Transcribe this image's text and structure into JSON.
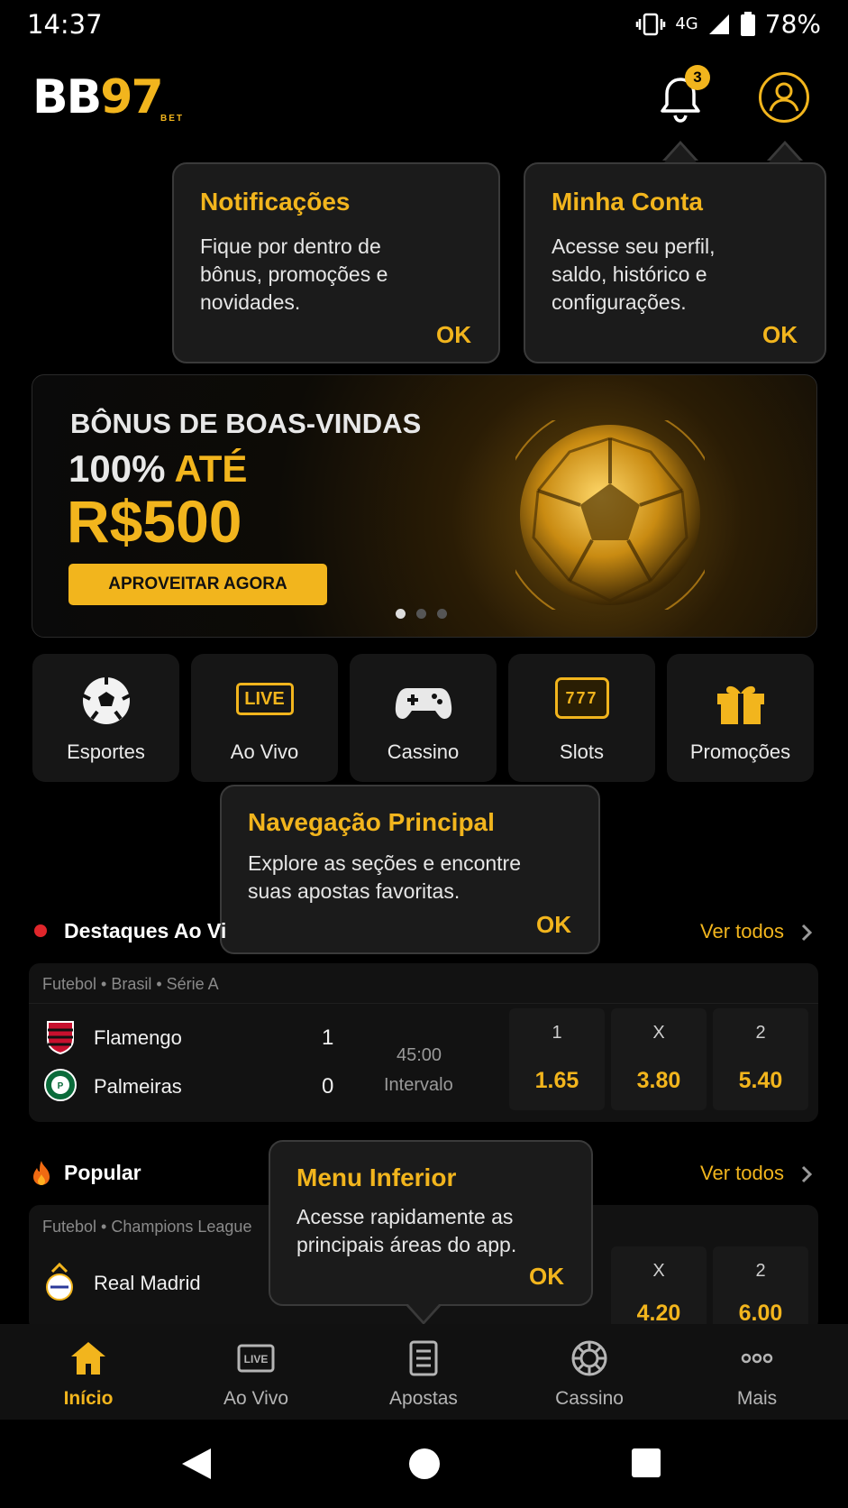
{
  "status": {
    "time": "14:37",
    "network": "4G",
    "battery": "78%"
  },
  "header": {
    "logo_bb": "BB",
    "logo_97": "97",
    "logo_sub": "BET",
    "notification_count": "3"
  },
  "tooltips": {
    "notifications": {
      "title": "Notificações",
      "line1": "Fique por dentro de",
      "line2": "bônus, promoções e",
      "line3": "novidades.",
      "ok": "OK"
    },
    "account": {
      "title": "Minha Conta",
      "line1": "Acesse seu perfil,",
      "line2": "saldo, histórico e",
      "line3": "configurações.",
      "ok": "OK"
    },
    "main_nav": {
      "title": "Navegação Principal",
      "line1": "Explore as seções e encontre",
      "line2": "suas apostas favoritas.",
      "ok": "OK"
    },
    "bottom_menu": {
      "title": "Menu Inferior",
      "line1": "Acesse rapidamente as",
      "line2": "principais áreas do app.",
      "ok": "OK"
    }
  },
  "banner": {
    "line1": "BÔNUS DE BOAS-VINDAS",
    "line2_a": "100%",
    "line2_b": "ATÉ",
    "amount": "R$500",
    "button": "APROVEITAR AGORA",
    "slides": 3,
    "active_slide": 1
  },
  "categories": [
    {
      "label": "Esportes",
      "icon": "soccer-ball-icon"
    },
    {
      "label": "Ao Vivo",
      "icon": "live-icon",
      "badge": "LIVE"
    },
    {
      "label": "Cassino",
      "icon": "gamepad-icon"
    },
    {
      "label": "Slots",
      "icon": "slot-machine-icon",
      "badge": "777"
    },
    {
      "label": "Promoções",
      "icon": "gift-icon"
    }
  ],
  "live_section": {
    "title": "Destaques Ao Vi",
    "see_all": "Ver todos",
    "match": {
      "league": "Futebol • Brasil • Série A",
      "home": "Flamengo",
      "home_score": "1",
      "away": "Palmeiras",
      "away_score": "0",
      "time": "45:00",
      "period": "Intervalo",
      "odds": [
        {
          "label": "1",
          "value": "1.65"
        },
        {
          "label": "X",
          "value": "3.80"
        },
        {
          "label": "2",
          "value": "5.40"
        }
      ]
    }
  },
  "popular_section": {
    "title": "Popular",
    "see_all": "Ver todos",
    "match": {
      "league": "Futebol • Champions League",
      "home": "Real Madrid",
      "odds": [
        {
          "label": "X",
          "value": "4.20"
        },
        {
          "label": "2",
          "value": "6.00"
        }
      ]
    }
  },
  "bottom_nav": [
    {
      "label": "Início",
      "icon": "home-icon",
      "active": true
    },
    {
      "label": "Ao Vivo",
      "icon": "live-tv-icon"
    },
    {
      "label": "Apostas",
      "icon": "bet-slip-icon"
    },
    {
      "label": "Cassino",
      "icon": "casino-chip-icon"
    },
    {
      "label": "Mais",
      "icon": "more-dots-icon"
    }
  ],
  "colors": {
    "accent": "#f2b51d",
    "background": "#000000",
    "card": "#121212",
    "live_dot": "#e0262b"
  }
}
